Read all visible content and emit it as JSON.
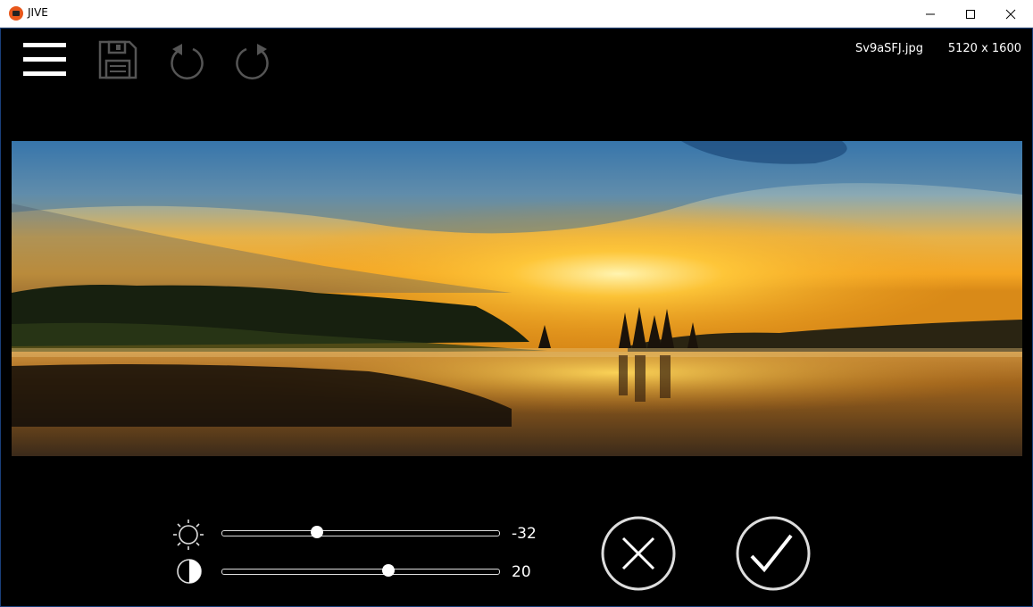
{
  "window": {
    "title": "JIVE",
    "controls": [
      "minimize-icon",
      "maximize-icon",
      "close-icon"
    ]
  },
  "toolbar": {
    "items": [
      "menu-icon",
      "save-icon",
      "undo-icon",
      "redo-icon"
    ]
  },
  "image_info": {
    "filename": "Sv9aSFJ.jpg",
    "dimensions": "5120 x 1600"
  },
  "adjustments": {
    "brightness": {
      "icon": "sun-icon",
      "value": "-32",
      "position": 0.34
    },
    "contrast": {
      "icon": "contrast-icon",
      "value": "20",
      "position": 0.6
    }
  },
  "actions": {
    "cancel": "close-circle-icon",
    "confirm": "checkmark-circle-icon"
  },
  "colors": {
    "background": "#000000",
    "icon_active": "#ffffff",
    "icon_disabled": "#555555",
    "app_icon": "#e8571b"
  }
}
